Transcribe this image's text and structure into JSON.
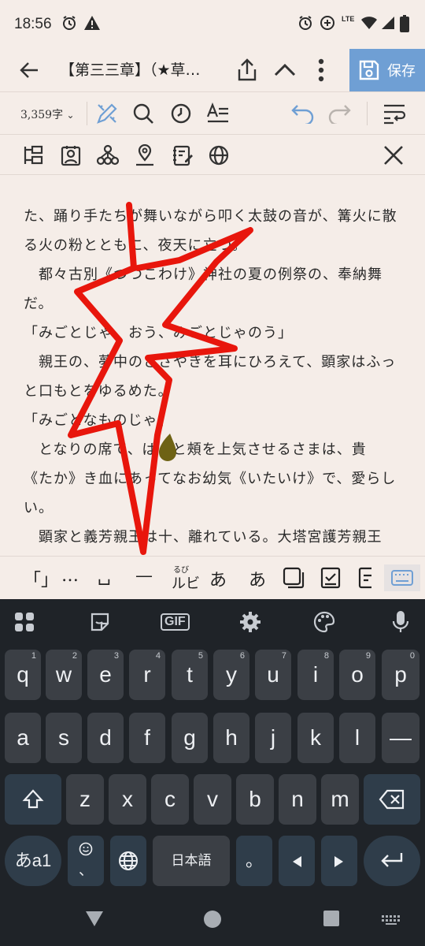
{
  "status_bar": {
    "time": "18:56",
    "network": "LTE"
  },
  "app_bar": {
    "title": "【第三三章】（★草…",
    "save_label": "保存"
  },
  "toolbar": {
    "char_count": "3,359字"
  },
  "editor": {
    "lines": [
      "た、踊り手たちが舞いながら叩く太鼓の音が、篝火に散",
      "る火の粉とともに、夜天に立つ。",
      "　都々古別《つつこわけ》神社の夏の例祭の、奉納舞",
      "だ。",
      "「みごとじゃ、おう、みごとじゃのう」",
      "　親王の、夢中のささやきを耳にひろえて、顕家はふっ",
      "と口もとをゆるめた。",
      "「みごとなものじゃ」",
      "　となりの席で、ぱっと頰を上気させるさまは、貴",
      "《たか》き血にあってなお幼気《いたいけ》で、愛らし",
      "い。",
      "　顕家と義芳親王は十、離れている。大塔宮護芳親王"
    ]
  },
  "helper_bar": {
    "brackets": "「」",
    "ellipsis": "…",
    "space": "␣",
    "dash": "—",
    "ruby_top": "るび",
    "ruby": "ルビ",
    "emphasis1": "あ",
    "emphasis2": "あ"
  },
  "keyboard": {
    "gif_label": "GIF",
    "rows": [
      [
        {
          "k": "q",
          "h": "1"
        },
        {
          "k": "w",
          "h": "2"
        },
        {
          "k": "e",
          "h": "3"
        },
        {
          "k": "r",
          "h": "4"
        },
        {
          "k": "t",
          "h": "5"
        },
        {
          "k": "y",
          "h": "6"
        },
        {
          "k": "u",
          "h": "7"
        },
        {
          "k": "i",
          "h": "8"
        },
        {
          "k": "o",
          "h": "9"
        },
        {
          "k": "p",
          "h": "0"
        }
      ],
      [
        {
          "k": "a"
        },
        {
          "k": "s"
        },
        {
          "k": "d"
        },
        {
          "k": "f"
        },
        {
          "k": "g"
        },
        {
          "k": "h"
        },
        {
          "k": "j"
        },
        {
          "k": "k"
        },
        {
          "k": "l"
        },
        {
          "k": "—"
        }
      ],
      [
        {
          "k": "z"
        },
        {
          "k": "x"
        },
        {
          "k": "c"
        },
        {
          "k": "v"
        },
        {
          "k": "b"
        },
        {
          "k": "n"
        },
        {
          "k": "m"
        }
      ]
    ],
    "mode_key": "あa1",
    "lang_key": "日本語",
    "period_key": "。",
    "emoji_comma": "、"
  },
  "colors": {
    "accent": "#6f9fd4",
    "background": "#f5ede8",
    "keyboard_bg": "#1f2328",
    "key_bg": "#3b3f45",
    "scribble": "#e8160c"
  }
}
